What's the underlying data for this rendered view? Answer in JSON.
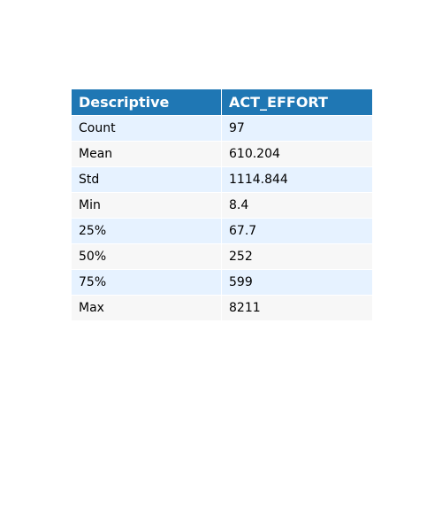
{
  "chart_data": {
    "type": "table",
    "columns": [
      "Descriptive",
      "ACT_EFFORT"
    ],
    "rows": [
      [
        "Count",
        "97"
      ],
      [
        "Mean",
        "610.204"
      ],
      [
        "Std",
        "1114.844"
      ],
      [
        "Min",
        "8.4"
      ],
      [
        "25%",
        "67.7"
      ],
      [
        "50%",
        "252"
      ],
      [
        "75%",
        "599"
      ],
      [
        "Max",
        "8211"
      ]
    ],
    "colors": {
      "header_bg": "#1f77b4",
      "header_text": "#ffffff",
      "row_even_bg": "#e6f2ff",
      "row_odd_bg": "#f7f7f7"
    }
  }
}
